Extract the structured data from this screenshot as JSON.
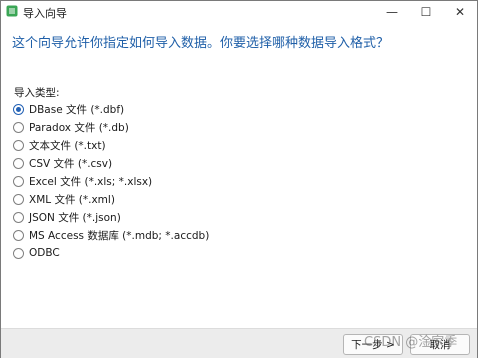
{
  "window": {
    "title": "导入向导",
    "icon": "spreadsheet-app-icon",
    "controls": {
      "minimize": "—",
      "maximize": "☐",
      "close": "✕"
    }
  },
  "heading": "这个向导允许你指定如何导入数据。你要选择哪种数据导入格式？",
  "import_type": {
    "label": "导入类型:",
    "selected": "DBase 文件 (*.dbf)",
    "options": [
      "DBase 文件 (*.dbf)",
      "Paradox 文件 (*.db)",
      "文本文件 (*.txt)",
      "CSV 文件 (*.csv)",
      "Excel 文件 (*.xls; *.xlsx)",
      "XML 文件 (*.xml)",
      "JSON 文件 (*.json)",
      "MS Access 数据库 (*.mdb; *.accdb)",
      "ODBC"
    ]
  },
  "footer": {
    "next_label": "下一步 >",
    "cancel_label": "取消",
    "watermark": "CSDN @淦家季"
  },
  "colors": {
    "accent": "#2462b5",
    "heading": "#1f5fa8"
  }
}
